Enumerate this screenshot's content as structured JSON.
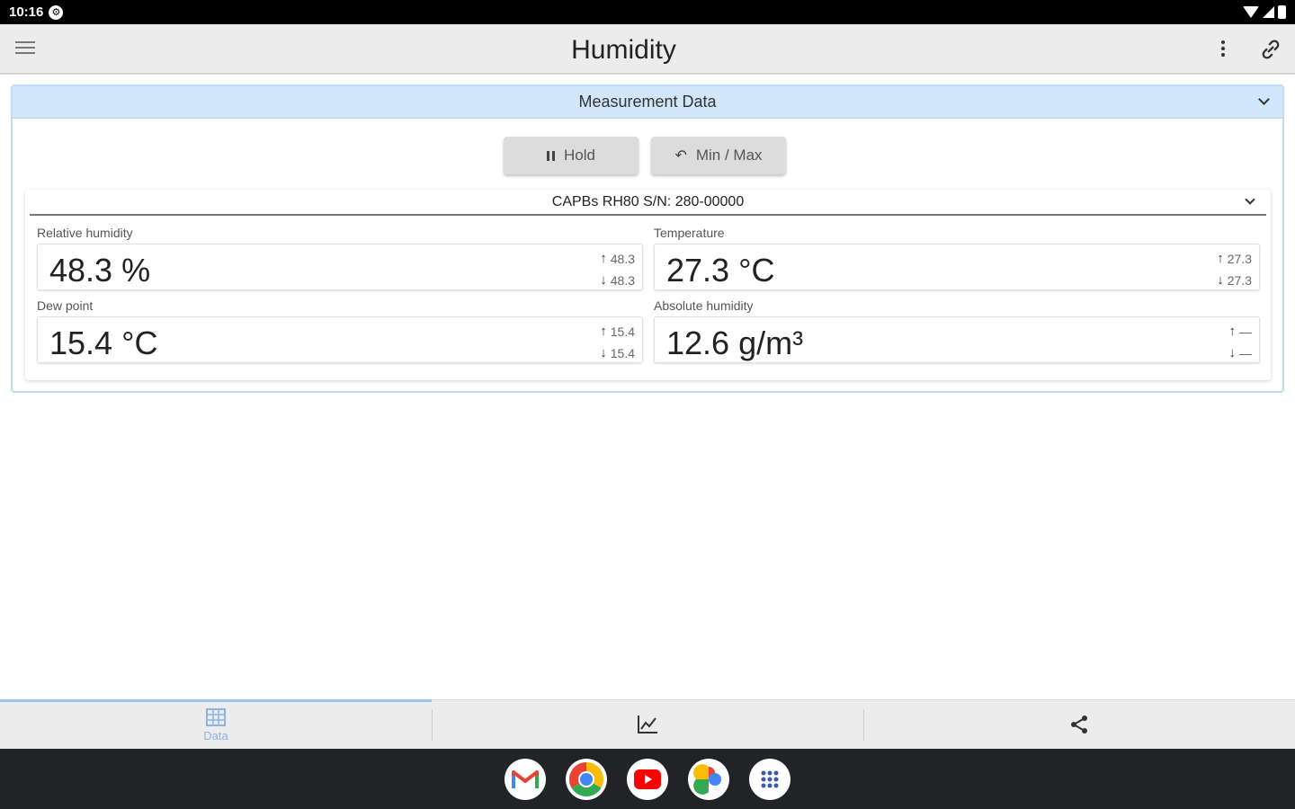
{
  "status_bar": {
    "time": "10:16"
  },
  "app_bar": {
    "title": "Humidity"
  },
  "panel": {
    "title": "Measurement Data",
    "hold_label": "Hold",
    "minmax_label": "Min / Max"
  },
  "device": {
    "name": "CAPBs RH80 S/N: 280-00000",
    "tiles": [
      {
        "label": "Relative humidity",
        "value": "48.3 %",
        "max": "48.3",
        "min": "48.3"
      },
      {
        "label": "Temperature",
        "value": "27.3 °C",
        "max": "27.3",
        "min": "27.3"
      },
      {
        "label": "Dew point",
        "value": "15.4 °C",
        "max": "15.4",
        "min": "15.4"
      },
      {
        "label": "Absolute humidity",
        "value": "12.6 g/m³",
        "max": "—",
        "min": "—"
      }
    ]
  },
  "bottom_nav": {
    "tabs": [
      {
        "label": "Data",
        "icon": "table-icon"
      },
      {
        "label": "",
        "icon": "chart-icon"
      },
      {
        "label": "",
        "icon": "share-icon"
      }
    ]
  },
  "dock": {
    "apps": [
      "gmail",
      "chrome",
      "youtube",
      "photos",
      "app-drawer"
    ]
  },
  "colors": {
    "header_blue": "#cfe6fb",
    "accent": "#8ab4e6"
  }
}
